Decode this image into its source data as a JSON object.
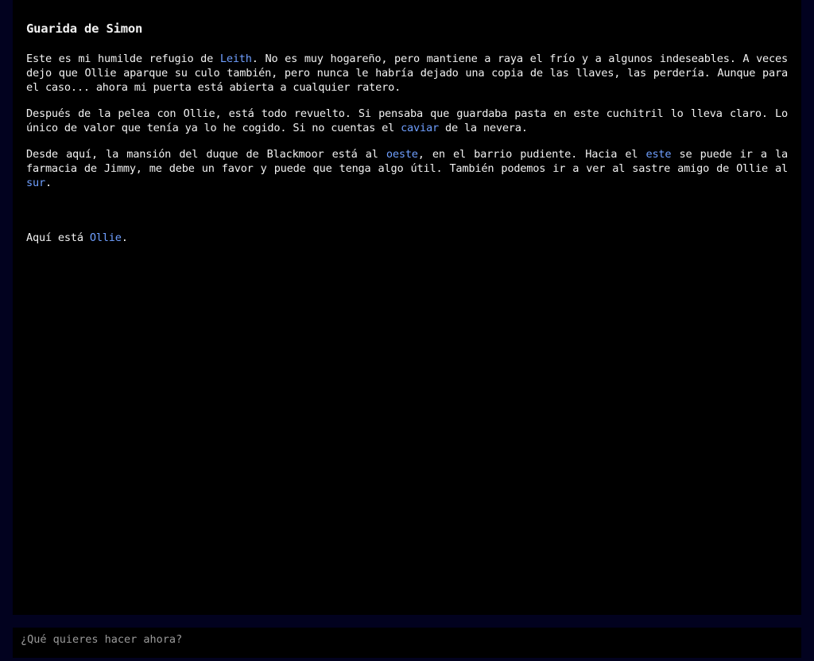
{
  "room": {
    "title": "Guarida de Simon",
    "paragraphs": [
      {
        "t1": "Este es mi humilde refugio de ",
        "link1": "Leith",
        "t2": ". No es muy hogareño, pero mantiene a raya el frío y a algunos indeseables. A veces dejo que Ollie aparque su culo también, pero nunca le habría dejado una copia de las llaves, las perdería. Aunque para el caso... ahora mi puerta está abierta a cualquier ratero."
      },
      {
        "t1": "Después de la pelea con Ollie, está todo revuelto. Si pensaba que guardaba pasta en este cuchitril lo lleva claro. Lo único de valor que tenía ya lo he cogido. Si no cuentas el ",
        "link1": "caviar",
        "t2": " de la nevera."
      },
      {
        "t1": "Desde aquí, la mansión del duque de Blackmoor está al ",
        "link1": "oeste",
        "t2": ", en el barrio pudiente. Hacia el ",
        "link2": "este",
        "t3": " se puede ir a la farmacia de Jimmy, me debe un favor y puede que tenga algo útil. También podemos ir a ver al sastre amigo de Ollie al ",
        "link3": "sur",
        "t4": "."
      }
    ],
    "presence": {
      "text": "Aquí está ",
      "link": "Ollie",
      "end": "."
    }
  },
  "command_input": {
    "placeholder": "¿Qué quieres hacer ahora?",
    "value": ""
  },
  "colors": {
    "background": "#02021f",
    "panel": "#000000",
    "text": "#f2f2f2",
    "link": "#6f9fff",
    "placeholder": "#9a9a9a"
  }
}
